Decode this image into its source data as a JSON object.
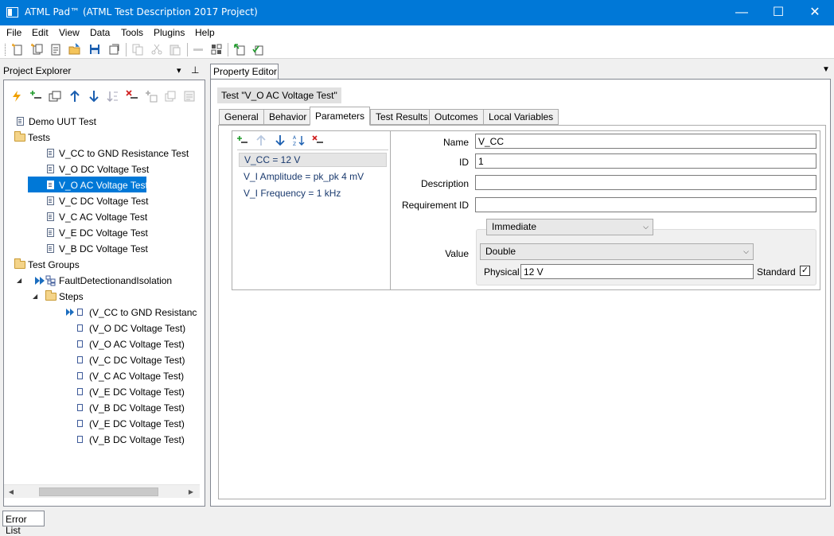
{
  "window": {
    "title": "ATML Pad™ (ATML Test Description 2017 Project)",
    "minimize": "—",
    "maximize": "☐",
    "close": "✕"
  },
  "menu": [
    "File",
    "Edit",
    "View",
    "Data",
    "Tools",
    "Plugins",
    "Help"
  ],
  "project_explorer": {
    "title": "Project Explorer",
    "dropdown": "▾",
    "pin": "⊥",
    "tree": {
      "root": "Demo UUT Test",
      "tests_folder": "Tests",
      "tests": [
        "V_CC to GND Resistance Test",
        "V_O DC Voltage Test",
        "V_O AC Voltage Test",
        "V_C DC Voltage Test",
        "V_C AC Voltage Test",
        "V_E DC Voltage Test",
        "V_B DC Voltage Test"
      ],
      "selected_test_index": 2,
      "groups_folder": "Test Groups",
      "group": "FaultDetectionandIsolation",
      "steps_folder": "Steps",
      "steps": [
        "(V_CC to GND Resistance T",
        "(V_O DC Voltage Test)",
        "(V_O AC Voltage Test)",
        "(V_C DC Voltage Test)",
        "(V_C AC Voltage Test)",
        "(V_E DC Voltage Test)",
        "(V_B DC Voltage Test)",
        "(V_E DC Voltage Test)",
        "(V_B DC Voltage Test)"
      ]
    }
  },
  "property_editor": {
    "title": "Property Editor",
    "menu_arrow": "▼",
    "heading": "Test \"V_O AC Voltage Test\"",
    "tabs": [
      "General",
      "Behavior",
      "Parameters",
      "Test Results",
      "Outcomes",
      "Local Variables"
    ],
    "active_tab": "Parameters",
    "parameters": [
      "V_CC = 12 V",
      "V_I Amplitude = pk_pk 4 mV",
      "V_I Frequency = 1 kHz"
    ],
    "fields": {
      "name_label": "Name",
      "name_value": "V_CC",
      "id_label": "ID",
      "id_value": "1",
      "description_label": "Description",
      "description_value": "",
      "requirement_label": "Requirement ID",
      "requirement_value": "",
      "value_label": "Value",
      "value_mode": "Immediate",
      "value_type": "Double",
      "physical_label": "Physical",
      "physical_value": "12 V",
      "standard_label": "Standard",
      "standard_checked": "✓"
    }
  },
  "bottom": {
    "error_list": "Error List"
  }
}
